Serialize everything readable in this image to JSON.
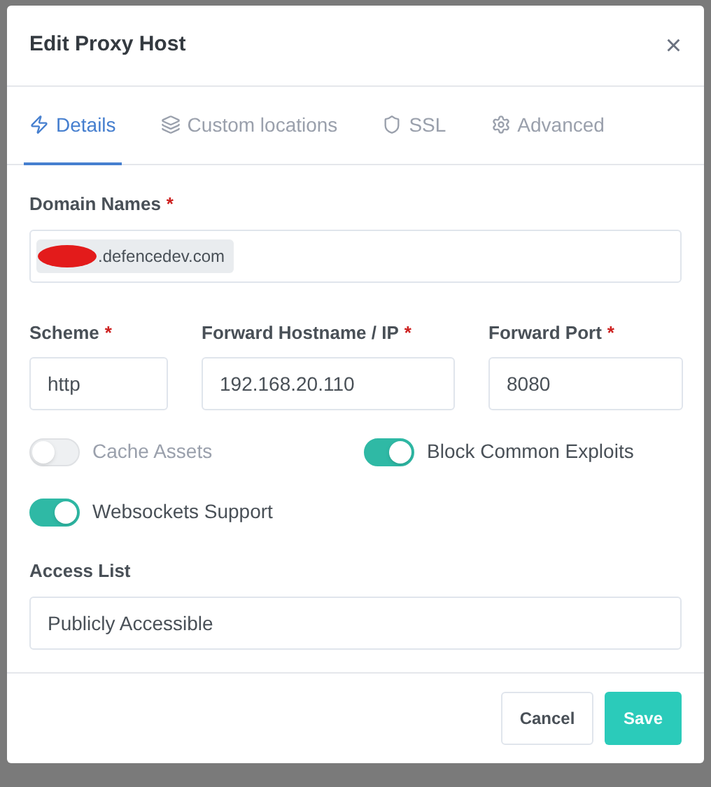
{
  "dialog": {
    "title": "Edit Proxy Host",
    "close": "×"
  },
  "tabs": [
    {
      "label": "Details",
      "kind": "details",
      "selected": true
    },
    {
      "label": "Custom locations",
      "kind": "locations",
      "selected": false
    },
    {
      "label": "SSL",
      "kind": "ssl",
      "selected": false
    },
    {
      "label": "Advanced",
      "kind": "advanced",
      "selected": false
    }
  ],
  "domain_names": {
    "label": "Domain Names",
    "required": "*",
    "tags": [
      {
        "text": ".defencedev.com",
        "redacted": true
      }
    ]
  },
  "fields": [
    {
      "label": "Scheme",
      "required": "*",
      "value": "http"
    },
    {
      "label": "Forward Hostname / IP",
      "required": "*",
      "value": "192.168.20.110"
    },
    {
      "label": "Forward Port",
      "required": "*",
      "value": "8080"
    }
  ],
  "toggles": [
    {
      "label": "Cache Assets",
      "on": false
    },
    {
      "label": "Block Common Exploits",
      "on": true
    },
    {
      "label": "Websockets Support",
      "on": true
    }
  ],
  "access_list": {
    "label": "Access List",
    "value": "Publicly Accessible"
  },
  "buttons": [
    {
      "label": "Cancel",
      "kind": "secondary"
    },
    {
      "label": "Save",
      "kind": "primary"
    }
  ]
}
